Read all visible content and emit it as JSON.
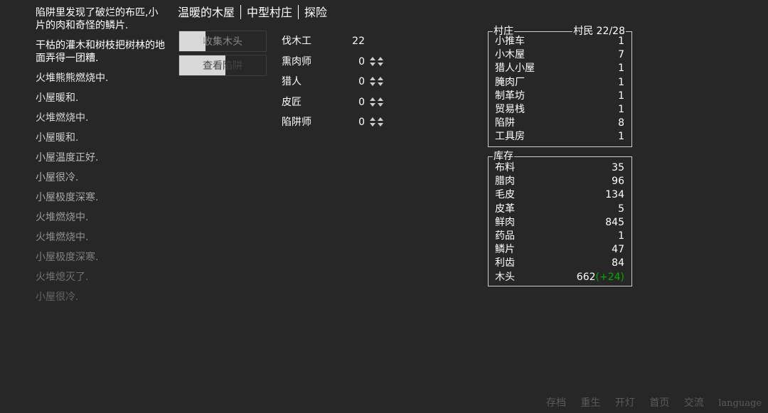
{
  "notifications": [
    {
      "text": "陷阱里发现了破烂的布匹,小片的肉和奇怪的鳞片.",
      "color": "#ffffff"
    },
    {
      "text": "干枯的灌木和树枝把树林的地面弄得一团糟.",
      "color": "#ffffff"
    },
    {
      "text": "火堆熊熊燃烧中.",
      "color": "#eeeeee"
    },
    {
      "text": "小屋暖和.",
      "color": "#e2e2e2"
    },
    {
      "text": "火堆燃烧中.",
      "color": "#d6d6d6"
    },
    {
      "text": "小屋暖和.",
      "color": "#cbcbcb"
    },
    {
      "text": "小屋温度正好.",
      "color": "#bfbfbf"
    },
    {
      "text": "小屋很冷.",
      "color": "#b3b3b3"
    },
    {
      "text": "小屋极度深寒.",
      "color": "#a6a6a6"
    },
    {
      "text": "火堆燃烧中.",
      "color": "#9a9a9a"
    },
    {
      "text": "火堆燃烧中.",
      "color": "#8d8d8d"
    },
    {
      "text": "小屋极度深寒.",
      "color": "#7f7f7f"
    },
    {
      "text": "火堆熄灭了.",
      "color": "#727272"
    },
    {
      "text": "小屋很冷.",
      "color": "#656565"
    }
  ],
  "header": {
    "tabs": [
      "温暖的木屋",
      "中型村庄",
      "探险"
    ]
  },
  "actions": {
    "gather_wood": {
      "label": "收集木头",
      "cooldown": 0.3
    },
    "check_traps": {
      "label": "查看陷阱",
      "cooldown": 0.53
    }
  },
  "workers": [
    {
      "name": "伐木工",
      "count": "22",
      "arrows": false
    },
    {
      "name": "熏肉师",
      "count": "0",
      "arrows": true
    },
    {
      "name": "猎人",
      "count": "0",
      "arrows": true
    },
    {
      "name": "皮匠",
      "count": "0",
      "arrows": true
    },
    {
      "name": "陷阱师",
      "count": "0",
      "arrows": true
    }
  ],
  "village": {
    "title": "村庄",
    "population_label": "村民 22/28",
    "buildings": [
      {
        "name": "小推车",
        "count": "1"
      },
      {
        "name": "小木屋",
        "count": "7"
      },
      {
        "name": "猎人小屋",
        "count": "1"
      },
      {
        "name": "腌肉厂",
        "count": "1"
      },
      {
        "name": "制革坊",
        "count": "1"
      },
      {
        "name": "贸易栈",
        "count": "1"
      },
      {
        "name": "陷阱",
        "count": "8"
      },
      {
        "name": "工具房",
        "count": "1"
      }
    ]
  },
  "stores": {
    "title": "库存",
    "items": [
      {
        "name": "布料",
        "count": "35",
        "income": ""
      },
      {
        "name": "腊肉",
        "count": "96",
        "income": ""
      },
      {
        "name": "毛皮",
        "count": "134",
        "income": ""
      },
      {
        "name": "皮革",
        "count": "5",
        "income": ""
      },
      {
        "name": "鲜肉",
        "count": "845",
        "income": ""
      },
      {
        "name": "药品",
        "count": "1",
        "income": ""
      },
      {
        "name": "鳞片",
        "count": "47",
        "income": ""
      },
      {
        "name": "利齿",
        "count": "84",
        "income": ""
      },
      {
        "name": "木头",
        "count": "662",
        "income": "(+24)"
      }
    ]
  },
  "footer": {
    "links": [
      "存档",
      "重生",
      "开灯",
      "首页",
      "交流"
    ],
    "language": "language"
  },
  "colors": {
    "background": "#272727",
    "text": "#ffffff",
    "income": "#00aa00",
    "footer": "#5a5a5a"
  }
}
